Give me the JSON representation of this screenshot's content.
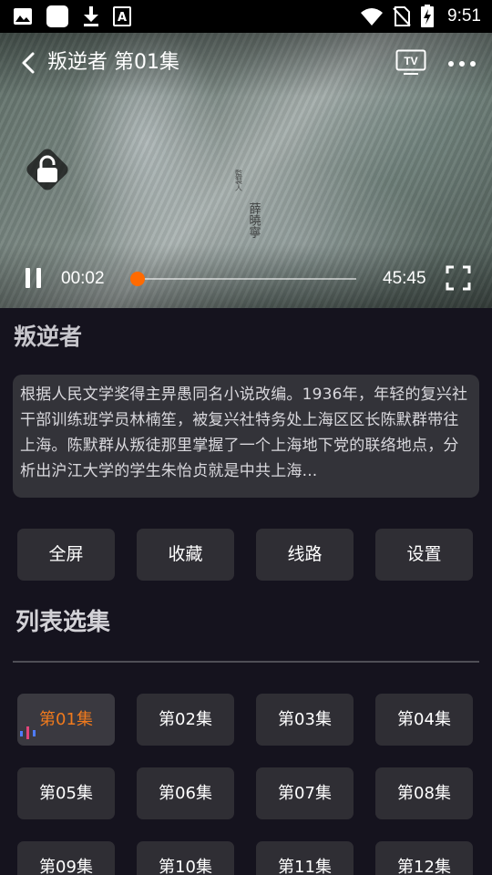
{
  "status_bar": {
    "time": "9:51",
    "left_icons": [
      "image-icon",
      "square-app-icon",
      "download-icon",
      "text-a-icon"
    ],
    "right_icons": [
      "wifi-icon",
      "no-sim-icon",
      "battery-charging-icon"
    ]
  },
  "player": {
    "title": "叛逆者 第01集",
    "current_time": "00:02",
    "total_time": "45:45",
    "progress": 0.01,
    "accent_color": "#ff6a00",
    "credit_text": "監製人 薛曉寧"
  },
  "show": {
    "title": "叛逆者",
    "description": "根据人民文学奖得主畀愚同名小说改编。1936年，年轻的复兴社干部训练班学员林楠笙，被复兴社特务处上海区区长陈默群带往上海。陈默群从叛徒那里掌握了一个上海地下党的联络地点，分析出沪江大学的学生朱怡贞就是中共上海..."
  },
  "actions": [
    "全屏",
    "收藏",
    "线路",
    "设置"
  ],
  "episodes_section": {
    "title": "列表选集",
    "active_index": 0,
    "active_color": "#f07a1d",
    "episodes": [
      "第01集",
      "第02集",
      "第03集",
      "第04集",
      "第05集",
      "第06集",
      "第07集",
      "第08集",
      "第09集",
      "第10集",
      "第11集",
      "第12集"
    ]
  }
}
